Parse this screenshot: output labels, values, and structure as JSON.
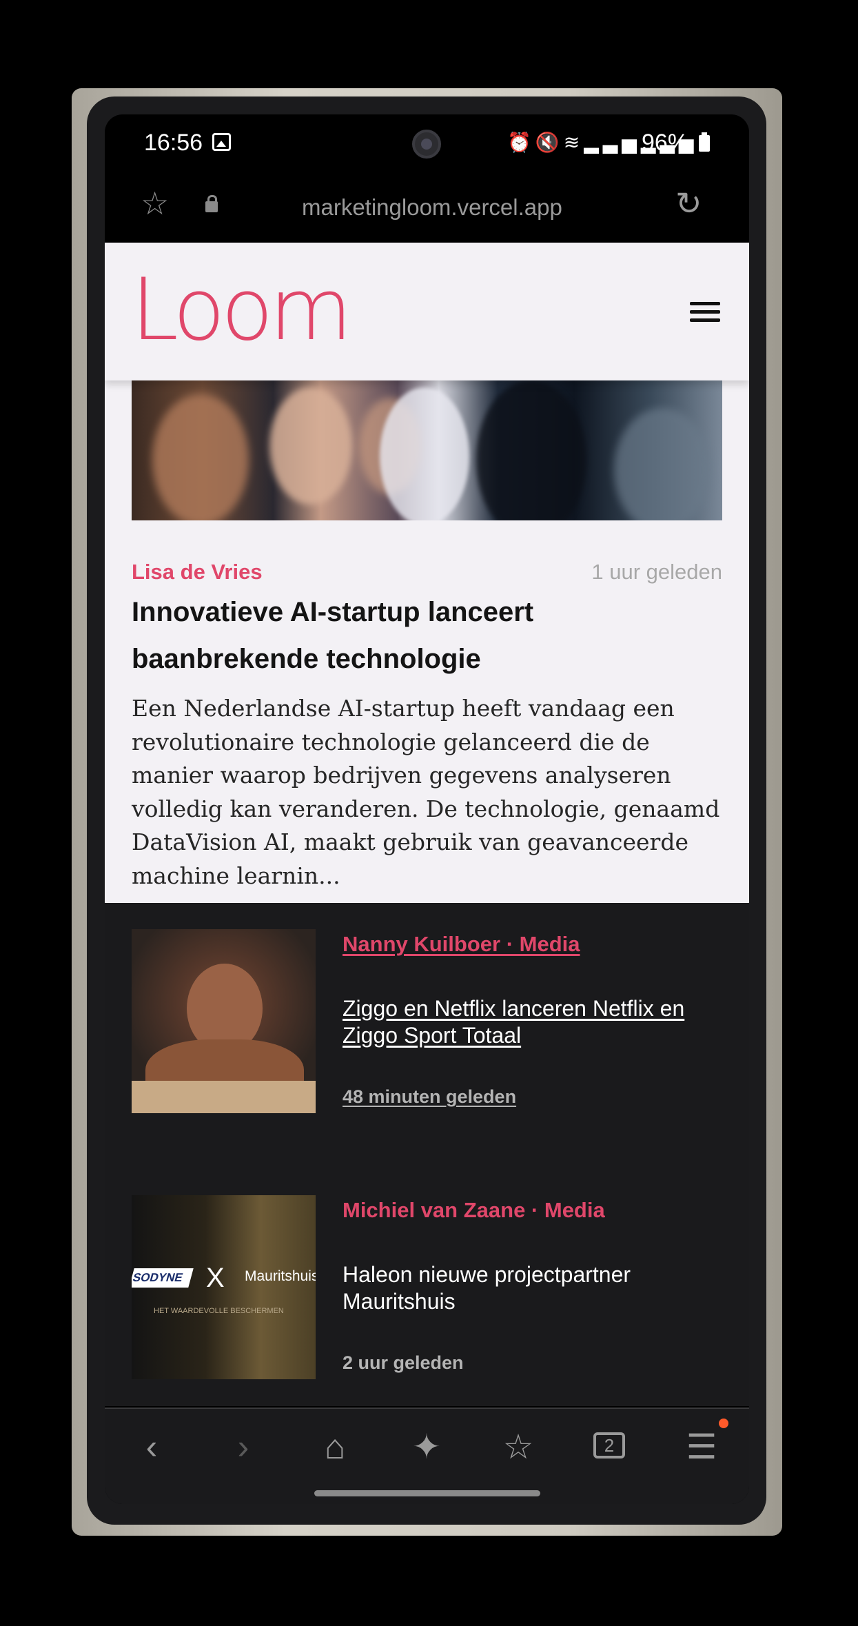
{
  "status_bar": {
    "time": "16:56",
    "icons": [
      "gallery-icon",
      "alarm-icon",
      "mute-icon",
      "wifi-icon",
      "signal-icon",
      "signal-icon",
      "battery-icon"
    ],
    "battery": "96%"
  },
  "browser": {
    "url": "marketingloom.vercel.app"
  },
  "site": {
    "logo": "Loom",
    "brand_color": "#e0476a"
  },
  "featured": {
    "author": "Lisa de Vries",
    "time_ago": "1 uur geleden",
    "headline": "Innovatieve AI-startup lanceert baanbrekende technologie",
    "excerpt": "Een Nederlandse AI-startup heeft vandaag een revolutionaire technologie gelanceerd die de manier waarop bedrijven gegevens analyseren volledig kan veranderen. De technologie, genaamd DataVision AI, maakt gebruik van geavanceerde machine learnin..."
  },
  "articles": [
    {
      "kicker": "Nanny Kuilboer · Media",
      "title": "Ziggo en Netflix lanceren Netflix en Ziggo Sport Totaal",
      "time_ago": "48 minuten geleden"
    },
    {
      "kicker": "Michiel van Zaane · Media",
      "title": "Haleon nieuwe projectpartner Mauritshuis",
      "time_ago": "2 uur geleden",
      "thumb_text": {
        "brand": "SODYNE",
        "cross": "X",
        "partner": "Mauritshuis",
        "tagline": "HET WAARDEVOLLE BESCHERMEN"
      }
    }
  ],
  "bottom_nav": {
    "tabs_count": "2",
    "items": [
      "back-icon",
      "forward-icon",
      "home-icon",
      "sparkle-icon",
      "bookmarks-icon",
      "tabs-icon",
      "menu-icon"
    ]
  }
}
